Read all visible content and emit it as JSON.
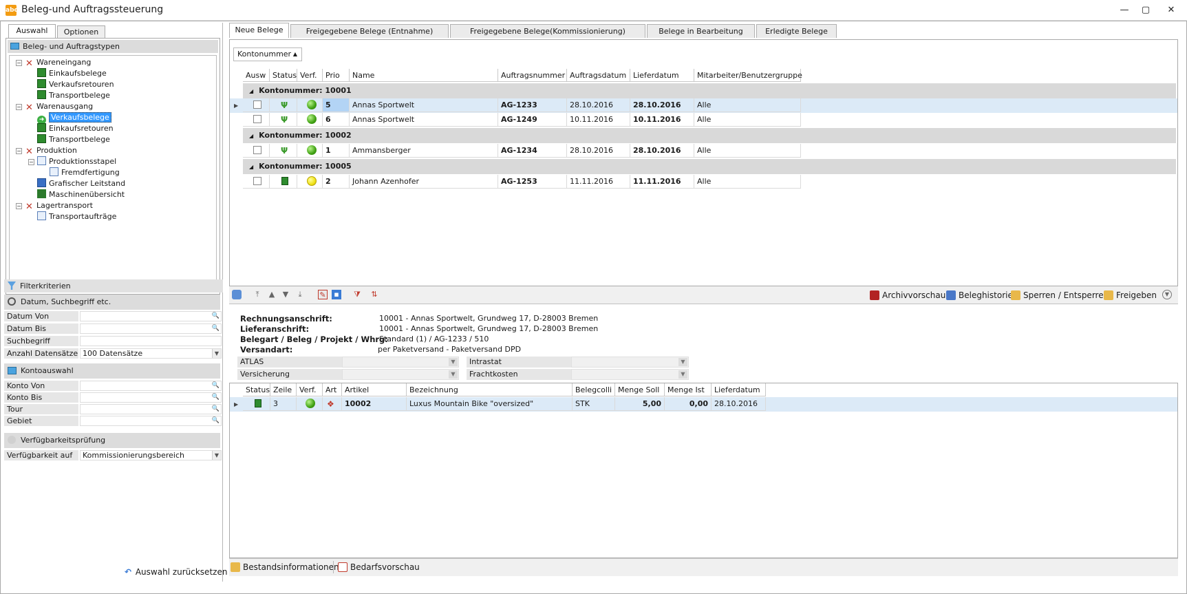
{
  "window": {
    "title": "Beleg-und Auftragssteuerung",
    "app_icon_text": "abc",
    "minimize": "—",
    "maximize": "▢",
    "close": "✕"
  },
  "left": {
    "tabs": [
      {
        "label": "Auswahl"
      },
      {
        "label": "Optionen"
      }
    ],
    "tree_header": "Beleg- und Auftragstypen",
    "tree": [
      {
        "label": "Wareneingang"
      },
      {
        "label": "Einkaufsbelege"
      },
      {
        "label": "Verkaufsretouren"
      },
      {
        "label": "Transportbelege"
      },
      {
        "label": "Warenausgang"
      },
      {
        "label": "Verkaufsbelege"
      },
      {
        "label": "Einkaufsretouren"
      },
      {
        "label": "Transportbelege"
      },
      {
        "label": "Produktion"
      },
      {
        "label": "Produktionsstapel"
      },
      {
        "label": "Fremdfertigung"
      },
      {
        "label": "Grafischer Leitstand"
      },
      {
        "label": "Maschinenübersicht"
      },
      {
        "label": "Lagertransport"
      },
      {
        "label": "Transportaufträge"
      }
    ],
    "filter_header": "Filterkriterien",
    "groups": {
      "datum": "Datum, Suchbegriff etc.",
      "konto": "Kontoauswahl",
      "verf": "Verfügbarkeitsprüfung"
    },
    "fields": {
      "datum_von": "Datum Von",
      "datum_bis": "Datum Bis",
      "suchbegriff": "Suchbegriff",
      "anzahl": "Anzahl Datensätze",
      "anzahl_value": "100 Datensätze",
      "konto_von": "Konto Von",
      "konto_bis": "Konto Bis",
      "tour": "Tour",
      "gebiet": "Gebiet",
      "verf_auf": "Verfügbarkeit auf",
      "verf_auf_value": "Kommissionierungsbereich"
    },
    "reset": "Auswahl zurücksetzen"
  },
  "tabs": [
    {
      "label": "Neue Belege"
    },
    {
      "label": "Freigegebene Belege (Entnahme)"
    },
    {
      "label": "Freigegebene Belege(Kommissionierung)"
    },
    {
      "label": "Belege in Bearbeitung"
    },
    {
      "label": "Erledigte Belege"
    }
  ],
  "grid": {
    "group_by_chip": "Kontonummer",
    "columns": [
      "Ausw",
      "Status",
      "Verf.",
      "Prio",
      "Name",
      "Auftragsnummer",
      "Auftragsdatum",
      "Lieferdatum",
      "Mitarbeiter/Benutzergruppe"
    ],
    "groups": [
      {
        "label": "Kontonummer: 10001"
      },
      {
        "label": "Kontonummer: 10002"
      },
      {
        "label": "Kontonummer: 10005"
      }
    ],
    "rows": [
      {
        "prio": "5",
        "name": "Annas Sportwelt",
        "auftrag": "AG-1233",
        "adatum": "28.10.2016",
        "ldatum": "28.10.2016",
        "mitarbeiter": "Alle"
      },
      {
        "prio": "6",
        "name": "Annas Sportwelt",
        "auftrag": "AG-1249",
        "adatum": "10.11.2016",
        "ldatum": "10.11.2016",
        "mitarbeiter": "Alle"
      },
      {
        "prio": "1",
        "name": "Ammansberger",
        "auftrag": "AG-1234",
        "adatum": "28.10.2016",
        "ldatum": "28.10.2016",
        "mitarbeiter": "Alle"
      },
      {
        "prio": "2",
        "name": "Johann Azenhofer",
        "auftrag": "AG-1253",
        "adatum": "11.11.2016",
        "ldatum": "11.11.2016",
        "mitarbeiter": "Alle"
      }
    ]
  },
  "toolbar": {
    "archiv": "Archivvorschau",
    "historie": "Beleghistorie",
    "sperren": "Sperren / Entsperren",
    "freigeben": "Freigeben"
  },
  "detail": {
    "rechnung_lbl": "Rechnungsanschrift:",
    "rechnung_val": "10001 - Annas Sportwelt, Grundweg 17, D-28003 Bremen",
    "liefer_lbl": "Lieferanschrift:",
    "liefer_val": "10001 - Annas Sportwelt, Grundweg 17, D-28003 Bremen",
    "belegart_lbl": "Belegart / Beleg / Projekt / Whrg:",
    "belegart_val": "Standard (1) / AG-1233 / 510",
    "versand_lbl": "Versandart:",
    "versand_val": "per Paketversand - Paketversand DPD",
    "atlas": "ATLAS",
    "intrastat": "Intrastat",
    "versicherung": "Versicherung",
    "frachtkosten": "Frachtkosten"
  },
  "grid2": {
    "columns": [
      "Status",
      "Zeile",
      "Verf.",
      "Art",
      "Artikel",
      "Bezeichnung",
      "Belegcolli",
      "Menge Soll",
      "Menge Ist",
      "Lieferdatum"
    ],
    "row": {
      "zeile": "3",
      "artikel": "10002",
      "bezeichnung": "Luxus Mountain Bike \"oversized\"",
      "colli": "STK",
      "soll": "5,00",
      "ist": "0,00",
      "datum": "28.10.2016"
    }
  },
  "bottom": {
    "bestand": "Bestandsinformationen",
    "bedarf": "Bedarfsvorschau"
  }
}
